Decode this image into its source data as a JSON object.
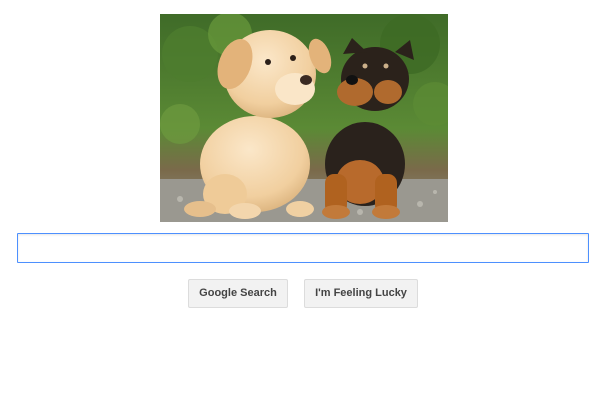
{
  "logo": {
    "description_icon": "puppies-photo"
  },
  "search": {
    "value": "",
    "placeholder": ""
  },
  "buttons": {
    "search_label": "Google Search",
    "lucky_label": "I'm Feeling Lucky"
  },
  "colors": {
    "input_focus_border": "#4d90fe",
    "button_bg": "#f2f2f2",
    "button_border": "#dcdcdc",
    "button_text": "#444444"
  }
}
